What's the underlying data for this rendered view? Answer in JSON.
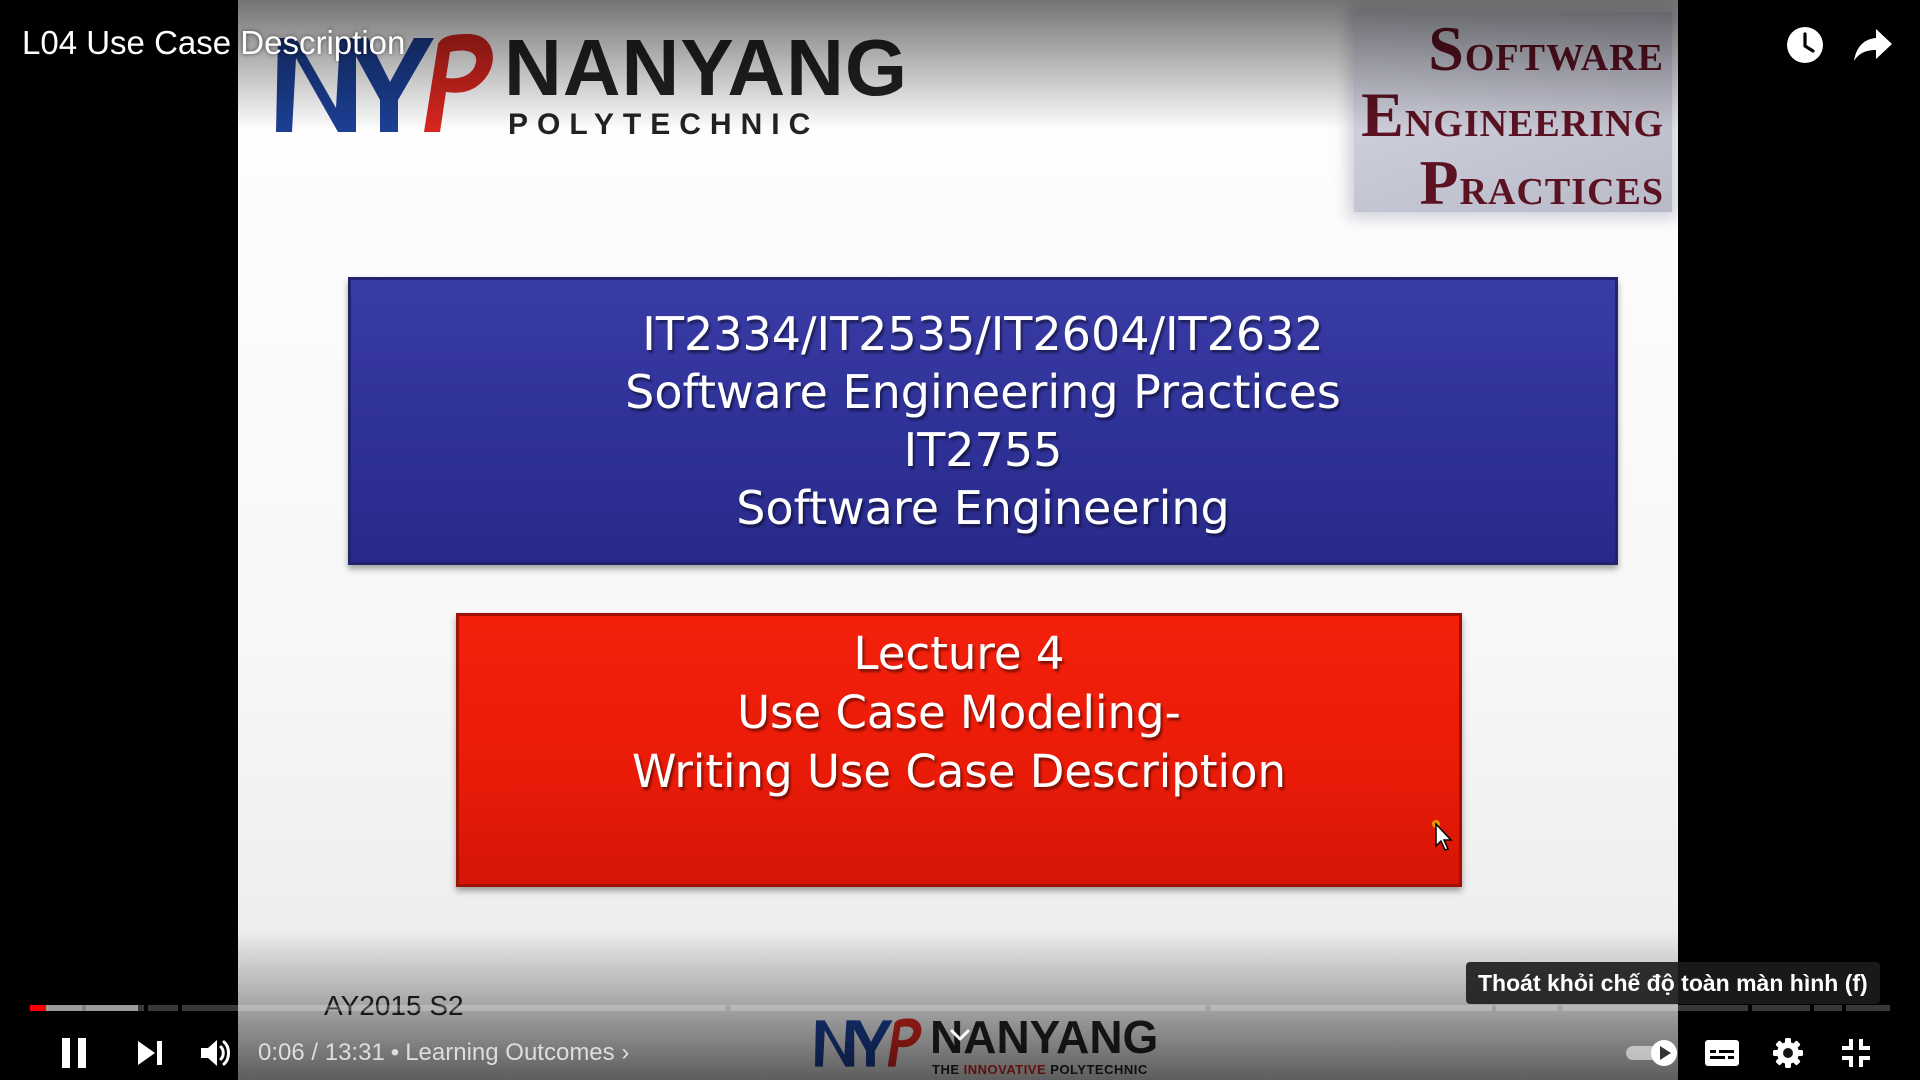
{
  "video": {
    "title": "L04 Use Case Description"
  },
  "slide": {
    "logo_name": "NANYANG",
    "logo_sub": "POLYTECHNIC",
    "sep_box": [
      {
        "initial": "S",
        "rest": "OFTWARE"
      },
      {
        "initial": "E",
        "rest": "NGINEERING"
      },
      {
        "initial": "P",
        "rest": "RACTICES"
      }
    ],
    "blue_lines": [
      "IT2334/IT2535/IT2604/IT2632",
      "Software Engineering Practices",
      "IT2755",
      "Software Engineering"
    ],
    "red_lines": [
      "Lecture 4",
      "Use Case Modeling-",
      "Writing Use Case Description"
    ],
    "year_text": "AY2015 S2",
    "bottom_logo": {
      "name": "NANYANG",
      "sub_pre": "THE ",
      "sub_accent": "INNOVATIVE",
      "sub_post": " POLYTECHNIC"
    },
    "colors": {
      "blue_box": "#2f3298",
      "red_box": "#e91b08",
      "nyp_blue": "#1c3f94",
      "nyp_red": "#d8261f",
      "sep_text": "#5b1222"
    }
  },
  "player": {
    "current_time": "0:06",
    "duration": "13:31",
    "time_separator": " / ",
    "chapter_label": "Learning Outcomes",
    "tooltip": "Thoát khỏi chế độ toàn màn hình (f)",
    "progress": {
      "played_fraction": 0.0044,
      "buffered_fraction": 0.058
    },
    "icons": {
      "top": [
        "watch-later-icon",
        "share-icon"
      ],
      "left": [
        "pause-icon",
        "next-icon",
        "volume-icon"
      ],
      "right": [
        "autoplay-toggle-icon",
        "subtitles-icon",
        "settings-icon",
        "exit-fullscreen-icon"
      ]
    },
    "accent_color": "#ff0000"
  }
}
